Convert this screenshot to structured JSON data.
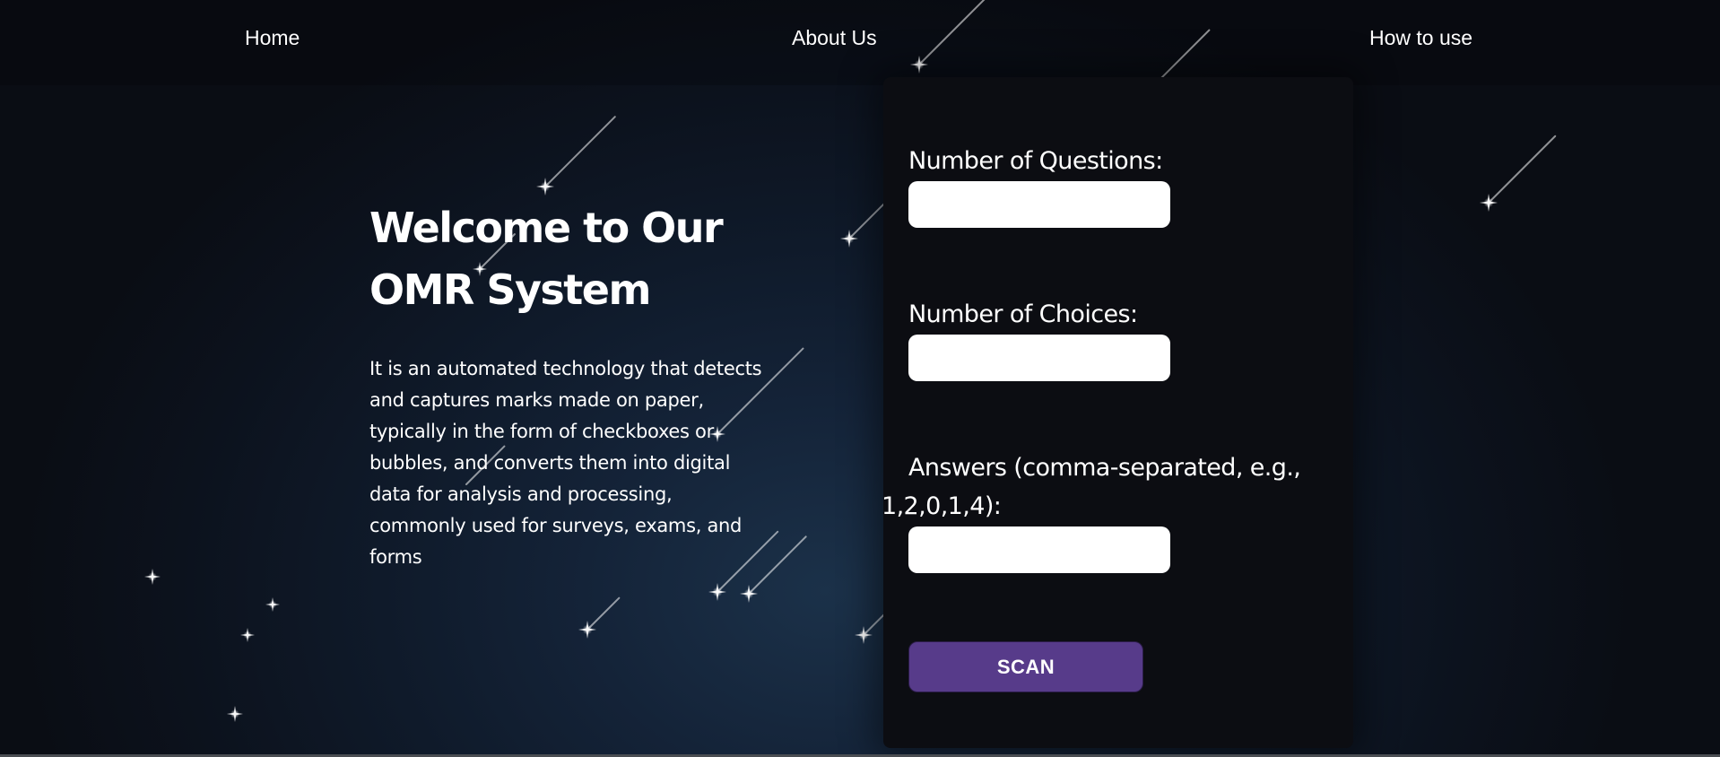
{
  "nav": {
    "home": "Home",
    "about": "About Us",
    "how_to_use": "How to use"
  },
  "hero": {
    "title": "Welcome to Our OMR System",
    "description": "It is an automated technology that detects and captures marks made on paper, typically in the form of checkboxes or bubbles, and converts them into digital data for analysis and processing, commonly used for surveys, exams, and forms"
  },
  "form": {
    "questions_label": "Number of Questions:",
    "questions_value": "",
    "choices_label": "Number of Choices:",
    "choices_value": "",
    "answers_label_line1": "Answers (comma-separated, e.g.,",
    "answers_label_line2": "1,2,0,1,4):",
    "answers_value": "",
    "scan_label": "SCAN"
  },
  "colors": {
    "card_background": "#0c0d12",
    "scan_button": "#573b8a",
    "input_background": "#ffffff",
    "text": "#ffffff"
  }
}
